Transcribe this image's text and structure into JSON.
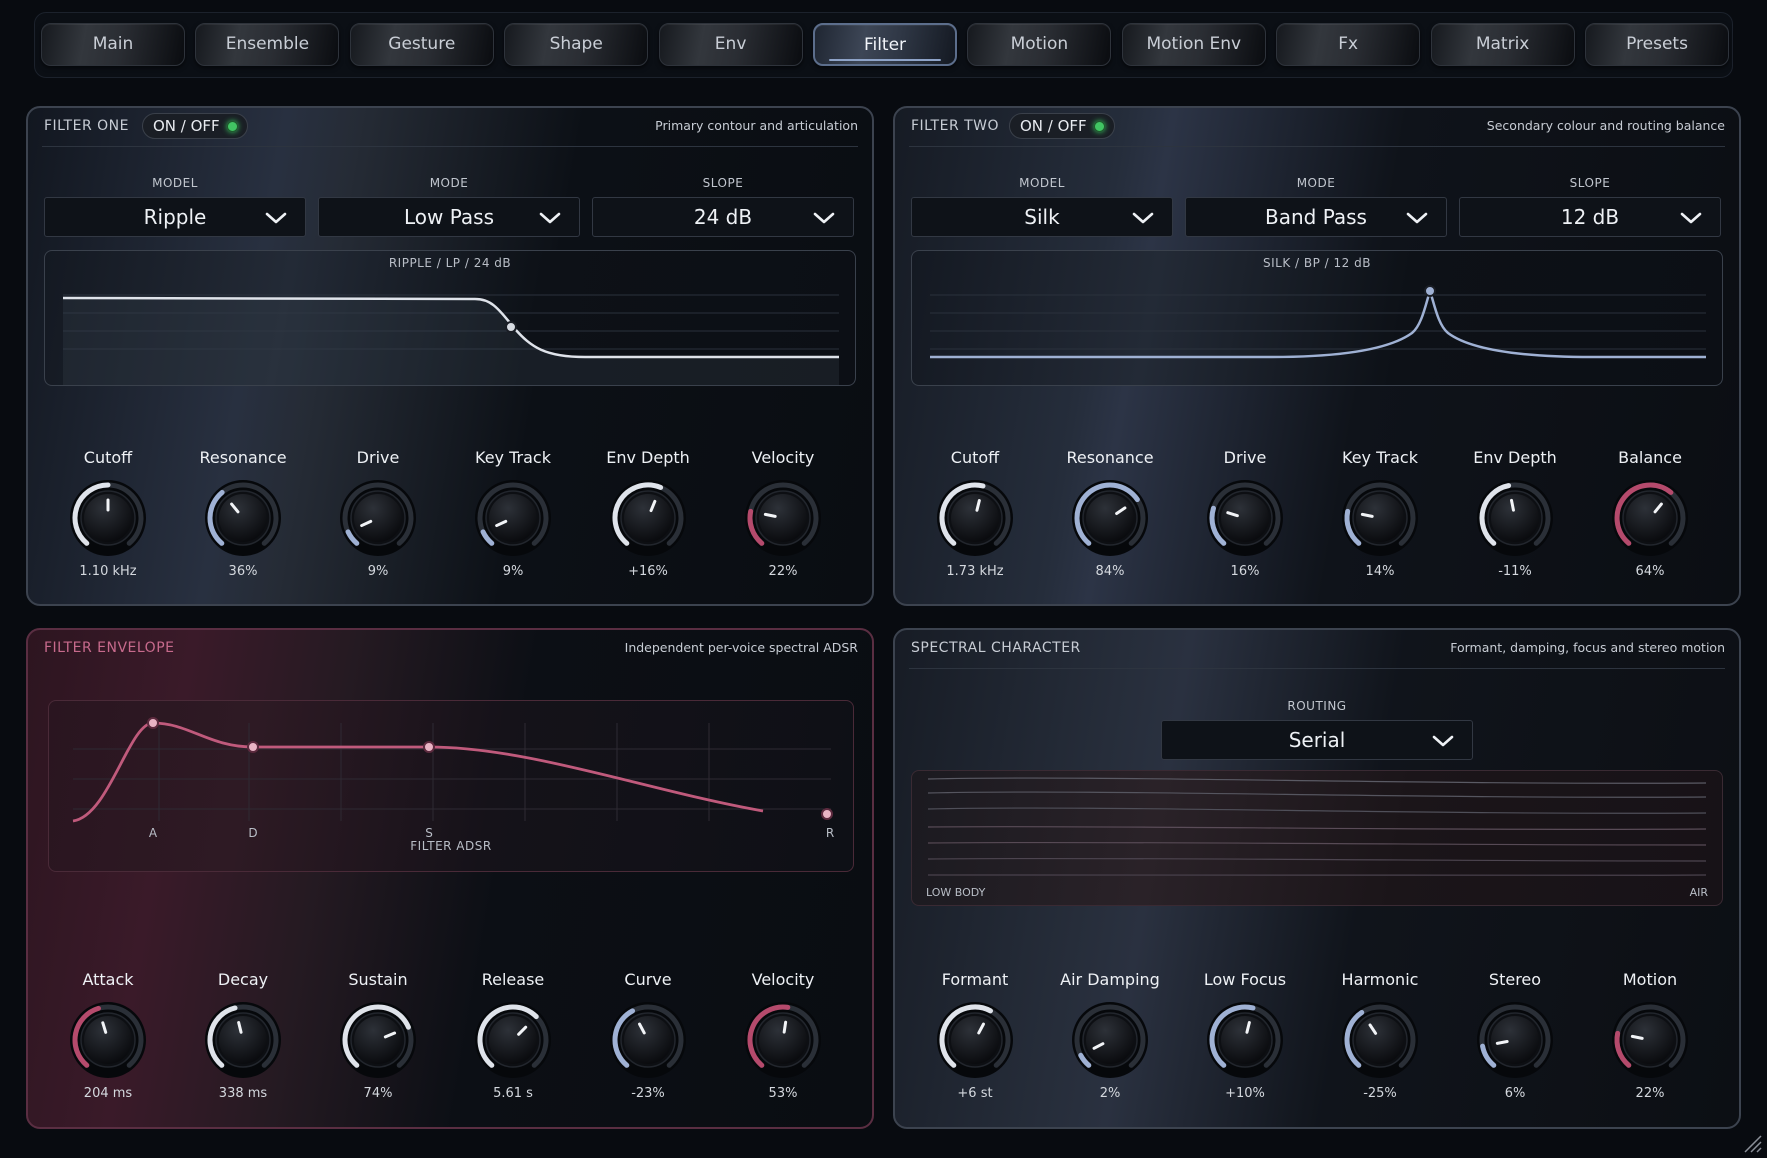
{
  "tabs": [
    {
      "label": "Main",
      "active": false
    },
    {
      "label": "Ensemble",
      "active": false
    },
    {
      "label": "Gesture",
      "active": false
    },
    {
      "label": "Shape",
      "active": false
    },
    {
      "label": "Env",
      "active": false
    },
    {
      "label": "Filter",
      "active": true
    },
    {
      "label": "Motion",
      "active": false
    },
    {
      "label": "Motion Env",
      "active": false
    },
    {
      "label": "Fx",
      "active": false
    },
    {
      "label": "Matrix",
      "active": false
    },
    {
      "label": "Presets",
      "active": false
    }
  ],
  "colors": {
    "accent_blue": "#9fb1d4",
    "accent_red": "#b54a6c",
    "led_on": "#41c463",
    "track": "#2a2f37",
    "knob_body": "#0d0f13"
  },
  "filter_one": {
    "title": "FILTER ONE",
    "toggle": "ON / OFF",
    "subtitle": "Primary contour and articulation",
    "model_label": "MODEL",
    "model": "Ripple",
    "mode_label": "MODE",
    "mode": "Low Pass",
    "slope_label": "SLOPE",
    "slope": "24 dB",
    "graph_caption": "RIPPLE  /  LP  /  24 dB",
    "knobs": [
      {
        "label": "Cutoff",
        "value": "1.10 kHz",
        "pos": 0.5,
        "color": "#dfe3ea"
      },
      {
        "label": "Resonance",
        "value": "36%",
        "pos": 0.36,
        "color": "#9fb1d4"
      },
      {
        "label": "Drive",
        "value": "9%",
        "pos": 0.09,
        "color": "#9fb1d4"
      },
      {
        "label": "Key Track",
        "value": "9%",
        "pos": 0.09,
        "color": "#9fb1d4"
      },
      {
        "label": "Env Depth",
        "value": "+16%",
        "pos": 0.58,
        "color": "#dfe3ea"
      },
      {
        "label": "Velocity",
        "value": "22%",
        "pos": 0.22,
        "color": "#b54a6c"
      }
    ]
  },
  "filter_two": {
    "title": "FILTER TWO",
    "toggle": "ON / OFF",
    "subtitle": "Secondary colour and routing balance",
    "model_label": "MODEL",
    "model": "Silk",
    "mode_label": "MODE",
    "mode": "Band Pass",
    "slope_label": "SLOPE",
    "slope": "12 dB",
    "graph_caption": "SILK  /  BP  /  12 dB",
    "knobs": [
      {
        "label": "Cutoff",
        "value": "1.73 kHz",
        "pos": 0.55,
        "color": "#dfe3ea"
      },
      {
        "label": "Resonance",
        "value": "84%",
        "pos": 0.7,
        "color": "#9fb1d4"
      },
      {
        "label": "Drive",
        "value": "16%",
        "pos": 0.24,
        "color": "#9fb1d4"
      },
      {
        "label": "Key Track",
        "value": "14%",
        "pos": 0.22,
        "color": "#9fb1d4"
      },
      {
        "label": "Env Depth",
        "value": "-11%",
        "pos": 0.46,
        "color": "#dfe3ea"
      },
      {
        "label": "Balance",
        "value": "64%",
        "pos": 0.64,
        "color": "#b54a6c"
      }
    ]
  },
  "filter_envelope": {
    "title": "FILTER ENVELOPE",
    "subtitle": "Independent per-voice spectral ADSR",
    "graph_caption": "FILTER ADSR",
    "point_labels": [
      "A",
      "D",
      "S",
      "R"
    ],
    "knobs": [
      {
        "label": "Attack",
        "value": "204 ms",
        "pos": 0.44,
        "color": "#b54a6c"
      },
      {
        "label": "Decay",
        "value": "338 ms",
        "pos": 0.45,
        "color": "#dfe3ea"
      },
      {
        "label": "Sustain",
        "value": "74%",
        "pos": 0.74,
        "color": "#dfe3ea"
      },
      {
        "label": "Release",
        "value": "5.61 s",
        "pos": 0.66,
        "color": "#dfe3ea"
      },
      {
        "label": "Curve",
        "value": "-23%",
        "pos": 0.4,
        "color": "#9fb1d4"
      },
      {
        "label": "Velocity",
        "value": "53%",
        "pos": 0.53,
        "color": "#b54a6c"
      }
    ]
  },
  "spectral_character": {
    "title": "SPECTRAL CHARACTER",
    "subtitle": "Formant, damping, focus and stereo motion",
    "routing_label": "ROUTING",
    "routing": "Serial",
    "low_label": "LOW BODY",
    "high_label": "AIR",
    "knobs": [
      {
        "label": "Formant",
        "value": "+6 st",
        "pos": 0.6,
        "color": "#dfe3ea"
      },
      {
        "label": "Air Damping",
        "value": "2%",
        "pos": 0.08,
        "color": "#9fb1d4"
      },
      {
        "label": "Low Focus",
        "value": "+10%",
        "pos": 0.55,
        "color": "#9fb1d4"
      },
      {
        "label": "Harmonic",
        "value": "-25%",
        "pos": 0.38,
        "color": "#9fb1d4"
      },
      {
        "label": "Stereo",
        "value": "6%",
        "pos": 0.14,
        "color": "#9fb1d4"
      },
      {
        "label": "Motion",
        "value": "22%",
        "pos": 0.22,
        "color": "#b54a6c"
      }
    ]
  }
}
